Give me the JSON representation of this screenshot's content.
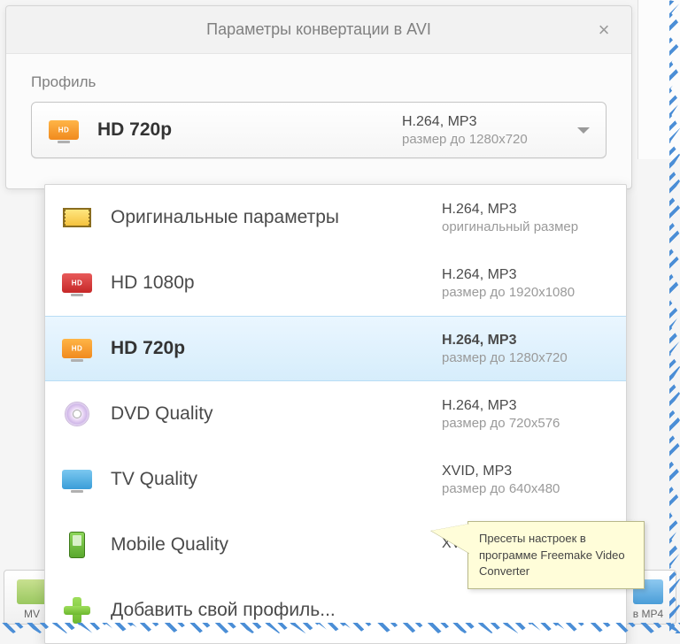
{
  "dialog": {
    "title": "Параметры конвертации в AVI",
    "close_symbol": "×",
    "profile_label": "Профиль"
  },
  "selected": {
    "label": "HD 720p",
    "codec": "H.264, MP3",
    "size": "размер до 1280x720",
    "icon": "monitor-orange"
  },
  "options": [
    {
      "label": "Оригинальные параметры",
      "codec": "H.264, MP3",
      "size": "оригинальный размер",
      "icon": "filmstrip",
      "highlighted": false
    },
    {
      "label": "HD 1080p",
      "codec": "H.264, MP3",
      "size": "размер до 1920x1080",
      "icon": "monitor-red",
      "highlighted": false
    },
    {
      "label": "HD 720p",
      "codec": "H.264, MP3",
      "size": "размер до 1280x720",
      "icon": "monitor-orange",
      "highlighted": true
    },
    {
      "label": "DVD Quality",
      "codec": "H.264, MP3",
      "size": "размер до 720x576",
      "icon": "disc",
      "highlighted": false
    },
    {
      "label": "TV Quality",
      "codec": "XVID, MP3",
      "size": "размер до 640x480",
      "icon": "monitor-blue",
      "highlighted": false
    },
    {
      "label": "Mobile Quality",
      "codec": "XVID, MP3",
      "size": "",
      "icon": "phone",
      "highlighted": false
    }
  ],
  "add_profile": "Добавить свой профиль...",
  "bottom": {
    "left": "MV",
    "right": "в MP4"
  },
  "callout": "Пресеты настроек в программе Freemake Video Converter"
}
